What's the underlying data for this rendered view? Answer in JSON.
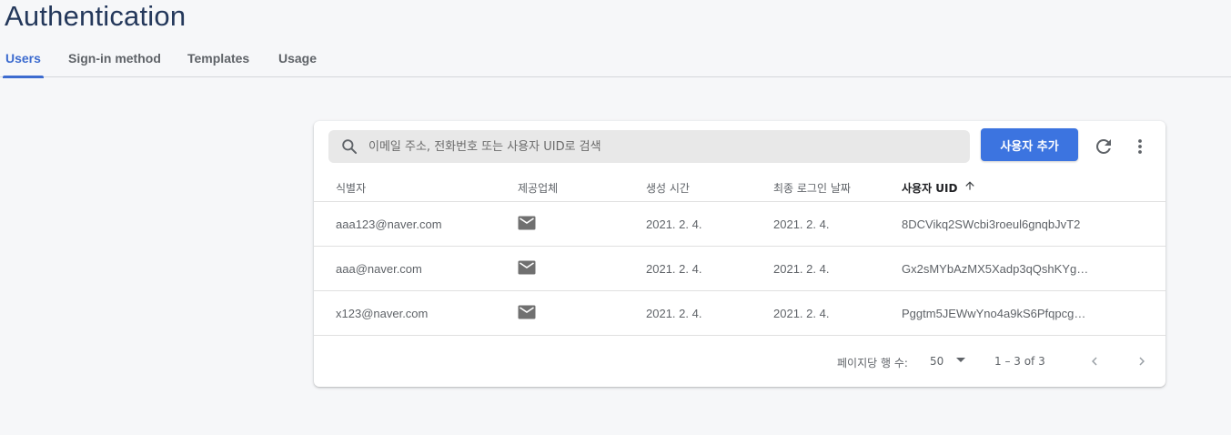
{
  "page": {
    "title": "Authentication",
    "tabs": [
      {
        "label": "Users",
        "active": true
      },
      {
        "label": "Sign-in method",
        "active": false
      },
      {
        "label": "Templates",
        "active": false
      },
      {
        "label": "Usage",
        "active": false
      }
    ]
  },
  "toolbar": {
    "search_placeholder": "이메일 주소, 전화번호 또는 사용자 UID로 검색",
    "add_user_label": "사용자 추가"
  },
  "table": {
    "columns": [
      "식별자",
      "제공업체",
      "생성 시간",
      "최종 로그인 날짜",
      "사용자 UID"
    ],
    "sorted_column": "사용자 UID",
    "sort_direction": "ascending",
    "rows": [
      {
        "identifier": "aaa123@naver.com",
        "provider": "mail-icon",
        "created": "2021. 2. 4.",
        "last_login": "2021. 2. 4.",
        "uid": "8DCVikq2SWcbi3roeul6gnqbJvT2"
      },
      {
        "identifier": "aaa@naver.com",
        "provider": "mail-icon",
        "created": "2021. 2. 4.",
        "last_login": "2021. 2. 4.",
        "uid": "Gx2sMYbAzMX5Xadp3qQshKYg9…"
      },
      {
        "identifier": "x123@naver.com",
        "provider": "mail-icon",
        "created": "2021. 2. 4.",
        "last_login": "2021. 2. 4.",
        "uid": "Pggtm5JEWwYno4a9kS6PfqpcgZ…"
      }
    ]
  },
  "pagination": {
    "rows_per_page_label": "페이지당 행 수:",
    "rows_per_page": "50",
    "range": "1 – 3 of 3"
  },
  "colors": {
    "accent": "#3c74e0",
    "active_tab": "#3c6bcf",
    "title": "#24385b"
  }
}
